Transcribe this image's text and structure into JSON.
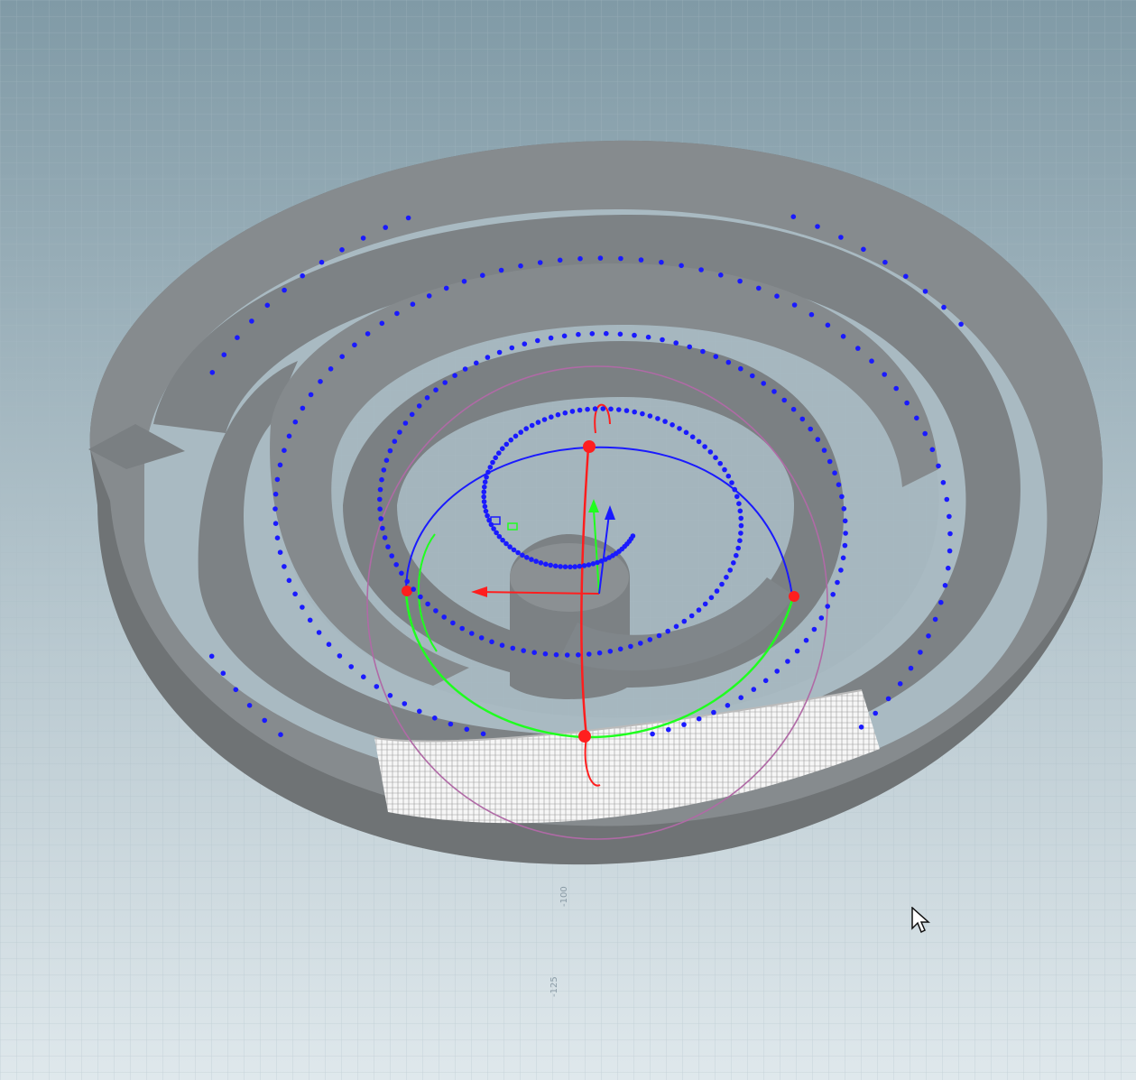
{
  "viewport": {
    "grid_labels": {
      "y_axis_100": "-100",
      "y_axis_125": "-125"
    }
  },
  "colors": {
    "background_top": "#809aa6",
    "background_bottom": "#dfe8ec",
    "geometry": "#858a8d",
    "geometry_side": "#6f7375",
    "point": "#1a1aff",
    "handle_x": "#ff1e1e",
    "handle_y": "#1fff1f",
    "handle_z": "#1a1aff",
    "guide": "#b06aa6",
    "tube": "#f4f4f4"
  },
  "icons": {
    "cursor": "mouse-pointer-icon"
  }
}
